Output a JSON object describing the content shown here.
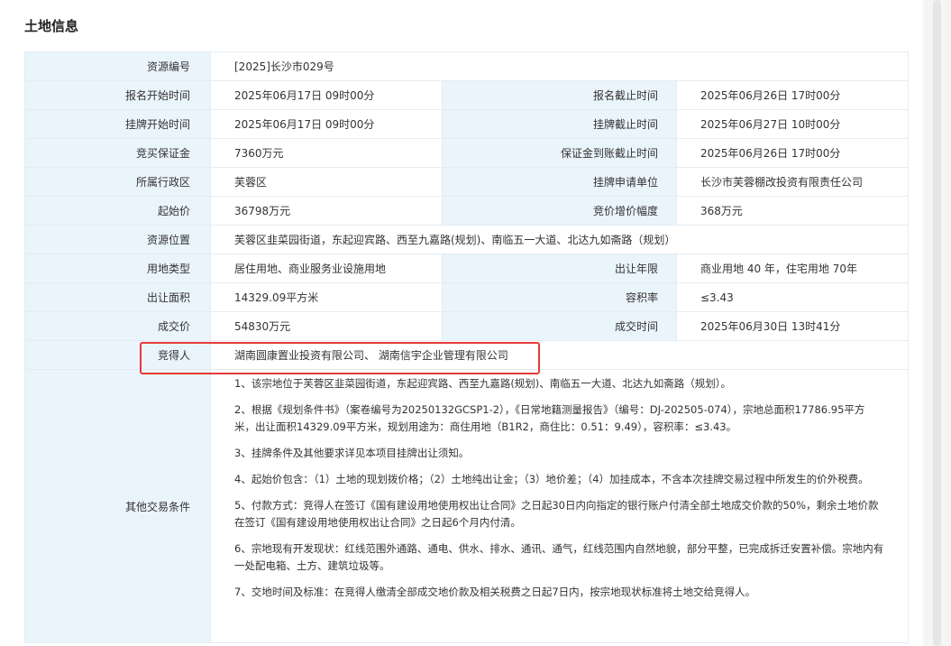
{
  "section_title": "土地信息",
  "rows": {
    "resource_no": {
      "label": "资源编号",
      "value": "[2025]长沙市029号"
    },
    "signup_start": {
      "label": "报名开始时间",
      "value": "2025年06月17日 09时00分"
    },
    "signup_end": {
      "label": "报名截止时间",
      "value": "2025年06月26日 17时00分"
    },
    "listing_start": {
      "label": "挂牌开始时间",
      "value": "2025年06月17日 09时00分"
    },
    "listing_end": {
      "label": "挂牌截止时间",
      "value": "2025年06月27日 10时00分"
    },
    "deposit": {
      "label": "竞买保证金",
      "value": "7360万元"
    },
    "deposit_deadline": {
      "label": "保证金到账截止时间",
      "value": "2025年06月26日 17时00分"
    },
    "district": {
      "label": "所属行政区",
      "value": "芙蓉区"
    },
    "applicant": {
      "label": "挂牌申请单位",
      "value": "长沙市芙蓉棚改投资有限责任公司"
    },
    "start_price": {
      "label": "起始价",
      "value": "36798万元"
    },
    "increment": {
      "label": "竞价增价幅度",
      "value": "368万元"
    },
    "location": {
      "label": "资源位置",
      "value": "芙蓉区韭菜园街道，东起迎宾路、西至九嘉路(规划)、南临五一大道、北达九如斋路（规划）"
    },
    "land_use": {
      "label": "用地类型",
      "value": "居住用地、商业服务业设施用地"
    },
    "term": {
      "label": "出让年限",
      "value": "商业用地 40 年，住宅用地 70年"
    },
    "area": {
      "label": "出让面积",
      "value": "14329.09平方米"
    },
    "far": {
      "label": "容积率",
      "value": "≤3.43"
    },
    "deal_price": {
      "label": "成交价",
      "value": "54830万元"
    },
    "deal_time": {
      "label": "成交时间",
      "value": "2025年06月30日 13时41分"
    },
    "winner": {
      "label": "竞得人",
      "value": "湖南圆康置业投资有限公司、 湖南信宇企业管理有限公司"
    },
    "other_terms": {
      "label": "其他交易条件",
      "items": [
        "1、该宗地位于芙蓉区韭菜园街道，东起迎宾路、西至九嘉路(规划)、南临五一大道、北达九如斋路（规划）。",
        "2、根据《规划条件书》（案卷编号为20250132GCSP1-2），《日常地籍测量报告》（编号：DJ-202505-074），宗地总面积17786.95平方米，出让面积14329.09平方米，规划用途为：商住用地（B1R2，商住比：0.51：9.49），容积率：≤3.43。",
        "3、挂牌条件及其他要求详见本项目挂牌出让须知。",
        "4、起始价包含：（1）土地的现划拨价格；（2）土地纯出让金；（3）地价差；（4）加挂成本，不含本次挂牌交易过程中所发生的价外税费。",
        "5、付款方式：竞得人在签订《国有建设用地使用权出让合同》之日起30日内向指定的银行账户付清全部土地成交价款的50%，剩余土地价款在签订《国有建设用地使用权出让合同》之日起6个月内付清。",
        "6、宗地现有开发现状：红线范围外通路、通电、供水、排水、通讯、通气，红线范围内自然地貌，部分平整，已完成拆迁安置补偿。宗地内有一处配电箱、土方、建筑垃圾等。",
        "7、交地时间及标准：在竞得人缴清全部成交地价款及相关税费之日起7日内，按宗地现状标准将土地交给竞得人。"
      ]
    }
  },
  "colors": {
    "label_bg": "#eaf4fb",
    "border": "#e4ecf2",
    "highlight": "#e63a3a"
  }
}
